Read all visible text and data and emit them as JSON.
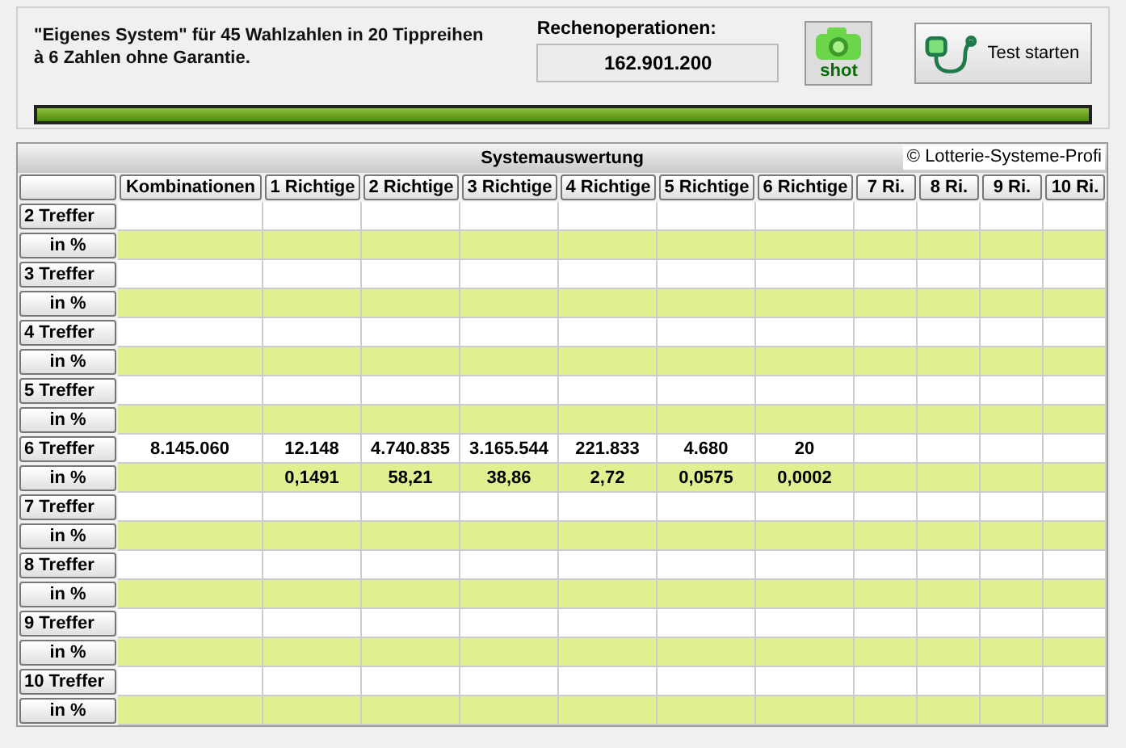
{
  "description": {
    "lines": [
      "\"Eigenes System\" für 45 Wahlzahlen in 20 Tippreihen",
      "à 6 Zahlen ohne Garantie."
    ]
  },
  "operations": {
    "label": "Rechenoperationen:",
    "value": "162.901.200"
  },
  "shot_button": {
    "label": "shot"
  },
  "test_button": {
    "label": "Test starten"
  },
  "progress": {
    "level": 1
  },
  "table": {
    "title": "Systemauswertung",
    "copyright": "© Lotterie-Systeme-Profi",
    "columns": [
      "Kombinationen",
      "1 Richtige",
      "2 Richtige",
      "3 Richtige",
      "4 Richtige",
      "5 Richtige",
      "6 Richtige",
      "7 Ri.",
      "8 Ri.",
      "9 Ri.",
      "10 Ri."
    ],
    "rows": [
      {
        "label": "2 Treffer",
        "kind": "count"
      },
      {
        "label": "in %",
        "kind": "percent"
      },
      {
        "label": "3 Treffer",
        "kind": "count"
      },
      {
        "label": "in %",
        "kind": "percent"
      },
      {
        "label": "4 Treffer",
        "kind": "count"
      },
      {
        "label": "in %",
        "kind": "percent"
      },
      {
        "label": "5 Treffer",
        "kind": "count"
      },
      {
        "label": "in %",
        "kind": "percent"
      },
      {
        "label": "6 Treffer",
        "kind": "count",
        "values": [
          "8.145.060",
          "12.148",
          "4.740.835",
          "3.165.544",
          "221.833",
          "4.680",
          "20"
        ]
      },
      {
        "label": "in %",
        "kind": "percent",
        "skips_combinations": true,
        "values": [
          "0,1491",
          "58,21",
          "38,86",
          "2,72",
          "0,0575",
          "0,0002"
        ]
      },
      {
        "label": "7 Treffer",
        "kind": "count"
      },
      {
        "label": "in %",
        "kind": "percent"
      },
      {
        "label": "8 Treffer",
        "kind": "count"
      },
      {
        "label": "in %",
        "kind": "percent"
      },
      {
        "label": "9 Treffer",
        "kind": "count"
      },
      {
        "label": "in %",
        "kind": "percent"
      },
      {
        "label": "10 Treffer",
        "kind": "count"
      },
      {
        "label": "in %",
        "kind": "percent"
      }
    ]
  }
}
